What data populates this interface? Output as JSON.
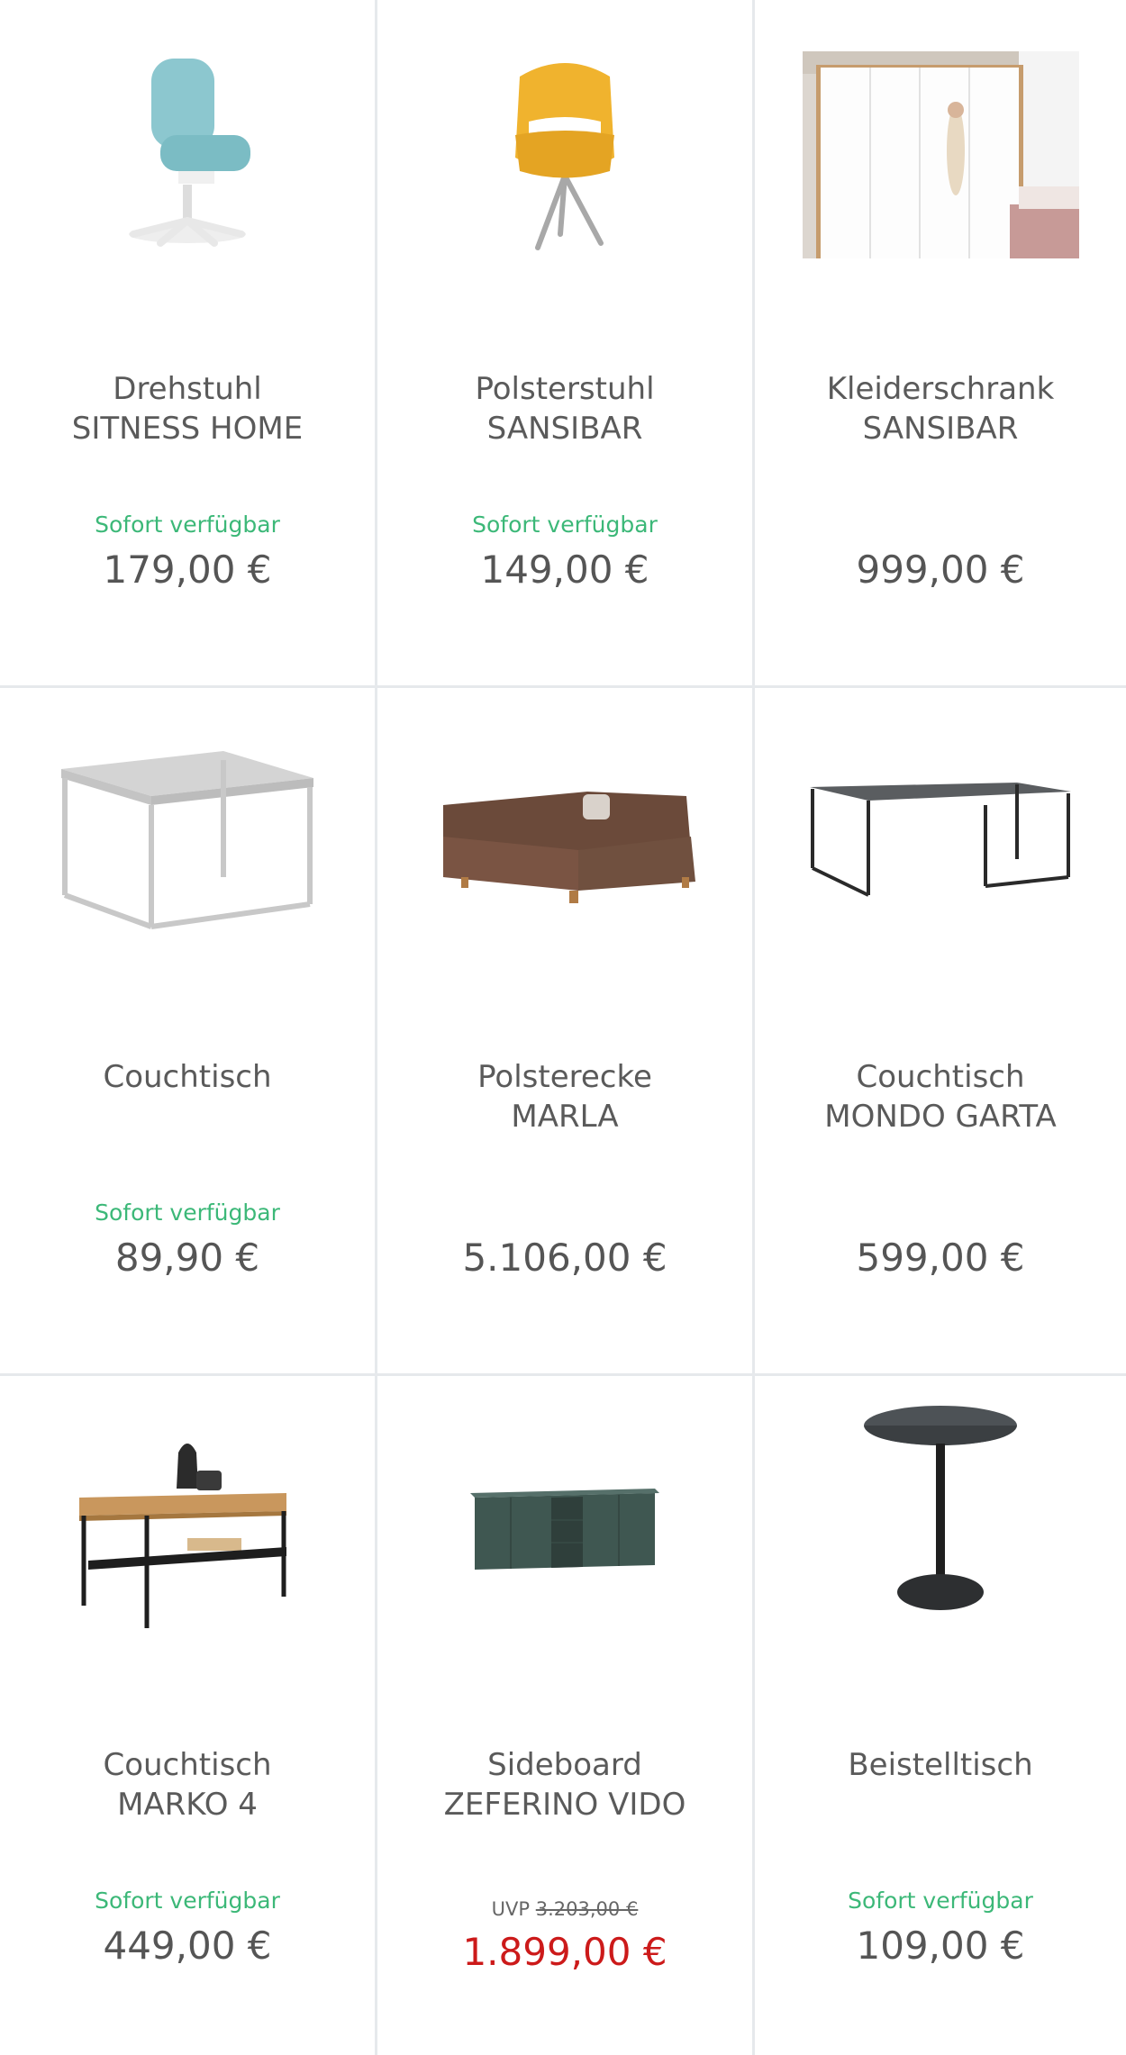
{
  "products": [
    {
      "title": "Drehstuhl",
      "subtitle": "SITNESS HOME",
      "availability": "Sofort verfügbar",
      "price": "179,00 €"
    },
    {
      "title": "Polsterstuhl",
      "subtitle": "SANSIBAR",
      "availability": "Sofort verfügbar",
      "price": "149,00 €"
    },
    {
      "title": "Kleiderschrank",
      "subtitle": "SANSIBAR",
      "availability": "",
      "price": "999,00 €"
    },
    {
      "title": "Couchtisch",
      "subtitle": "",
      "availability": "Sofort verfügbar",
      "price": "89,90 €"
    },
    {
      "title": "Polsterecke",
      "subtitle": "MARLA",
      "availability": "",
      "price": "5.106,00 €"
    },
    {
      "title": "Couchtisch",
      "subtitle": "MONDO GARTA",
      "availability": "",
      "price": "599,00 €"
    },
    {
      "title": "Couchtisch",
      "subtitle": "MARKO 4",
      "availability": "Sofort verfügbar",
      "price": "449,00 €"
    },
    {
      "title": "Sideboard",
      "subtitle": "ZEFERINO VIDO",
      "availability": "",
      "uvp_label": "UVP",
      "uvp_price": "3.203,00 €",
      "price": "1.899,00 €"
    },
    {
      "title": "Beistelltisch",
      "subtitle": "",
      "availability": "Sofort verfügbar",
      "price": "109,00 €"
    }
  ],
  "colors": {
    "availability": "#3cb878",
    "sale_price": "#cc1a1a",
    "divider": "#e6e9ec"
  }
}
